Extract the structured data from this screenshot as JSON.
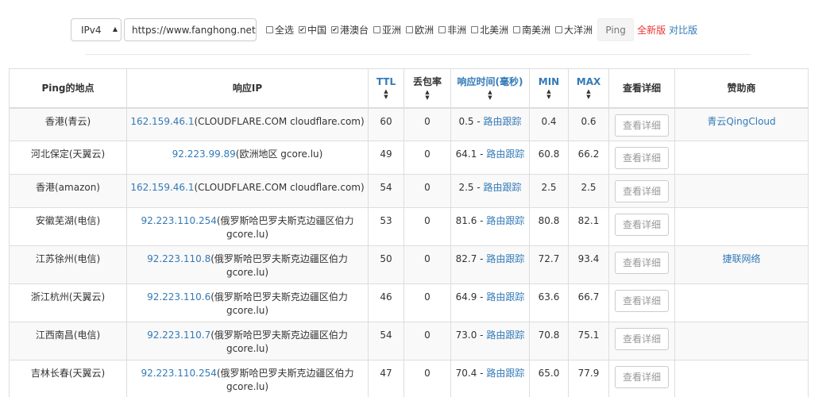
{
  "toolbar": {
    "ip_version": "IPv4",
    "url": "https://www.fanghong.net",
    "checkboxes": [
      {
        "label": "全选",
        "checked": false
      },
      {
        "label": "中国",
        "checked": true
      },
      {
        "label": "港澳台",
        "checked": true
      },
      {
        "label": "亚洲",
        "checked": false
      },
      {
        "label": "欧洲",
        "checked": false
      },
      {
        "label": "非洲",
        "checked": false
      },
      {
        "label": "北美洲",
        "checked": false
      },
      {
        "label": "南美洲",
        "checked": false
      },
      {
        "label": "大洋洲",
        "checked": false
      }
    ],
    "ping_label": "Ping",
    "new_version": "全新版",
    "compare_version": "对比版"
  },
  "table": {
    "headers": {
      "location": "Ping的地点",
      "ip": "响应IP",
      "ttl": "TTL",
      "loss": "丢包率",
      "rtt": "响应时间(毫秒)",
      "min": "MIN",
      "max": "MAX",
      "detail": "查看详细",
      "sponsor": "赞助商"
    },
    "rows": [
      {
        "location": "香港(青云)",
        "ip": "162.159.46.1",
        "ip_info": "(CLOUDFLARE.COM cloudflare.com)",
        "ttl": "60",
        "loss": "0",
        "rtt": "0.5",
        "trace": "路由跟踪",
        "min": "0.4",
        "max": "0.6",
        "detail": "查看详细",
        "sponsor": "青云QingCloud"
      },
      {
        "location": "河北保定(天翼云)",
        "ip": "92.223.99.89",
        "ip_info": "(欧洲地区 gcore.lu)",
        "ttl": "49",
        "loss": "0",
        "rtt": "64.1",
        "trace": "路由跟踪",
        "min": "60.8",
        "max": "66.2",
        "detail": "查看详细",
        "sponsor": ""
      },
      {
        "location": "香港(amazon)",
        "ip": "162.159.46.1",
        "ip_info": "(CLOUDFLARE.COM cloudflare.com)",
        "ttl": "54",
        "loss": "0",
        "rtt": "2.5",
        "trace": "路由跟踪",
        "min": "2.5",
        "max": "2.5",
        "detail": "查看详细",
        "sponsor": ""
      },
      {
        "location": "安徽芜湖(电信)",
        "ip": "92.223.110.254",
        "ip_info": "(俄罗斯哈巴罗夫斯克边疆区伯力 gcore.lu)",
        "ttl": "53",
        "loss": "0",
        "rtt": "81.6",
        "trace": "路由跟踪",
        "min": "80.8",
        "max": "82.1",
        "detail": "查看详细",
        "sponsor": ""
      },
      {
        "location": "江苏徐州(电信)",
        "ip": "92.223.110.8",
        "ip_info": "(俄罗斯哈巴罗夫斯克边疆区伯力 gcore.lu)",
        "ttl": "50",
        "loss": "0",
        "rtt": "82.7",
        "trace": "路由跟踪",
        "min": "72.7",
        "max": "93.4",
        "detail": "查看详细",
        "sponsor": "捷联网络"
      },
      {
        "location": "浙江杭州(天翼云)",
        "ip": "92.223.110.6",
        "ip_info": "(俄罗斯哈巴罗夫斯克边疆区伯力 gcore.lu)",
        "ttl": "46",
        "loss": "0",
        "rtt": "64.9",
        "trace": "路由跟踪",
        "min": "63.6",
        "max": "66.7",
        "detail": "查看详细",
        "sponsor": ""
      },
      {
        "location": "江西南昌(电信)",
        "ip": "92.223.110.7",
        "ip_info": "(俄罗斯哈巴罗夫斯克边疆区伯力 gcore.lu)",
        "ttl": "54",
        "loss": "0",
        "rtt": "73.0",
        "trace": "路由跟踪",
        "min": "70.8",
        "max": "75.1",
        "detail": "查看详细",
        "sponsor": ""
      },
      {
        "location": "吉林长春(天翼云)",
        "ip": "92.223.110.254",
        "ip_info": "(俄罗斯哈巴罗夫斯克边疆区伯力 gcore.lu)",
        "ttl": "47",
        "loss": "0",
        "rtt": "70.4",
        "trace": "路由跟踪",
        "min": "65.0",
        "max": "77.9",
        "detail": "查看详细",
        "sponsor": ""
      }
    ]
  },
  "icons": {
    "select_arrow": "caret-down-icon",
    "sort": "sort-icon",
    "check": "check-icon"
  }
}
